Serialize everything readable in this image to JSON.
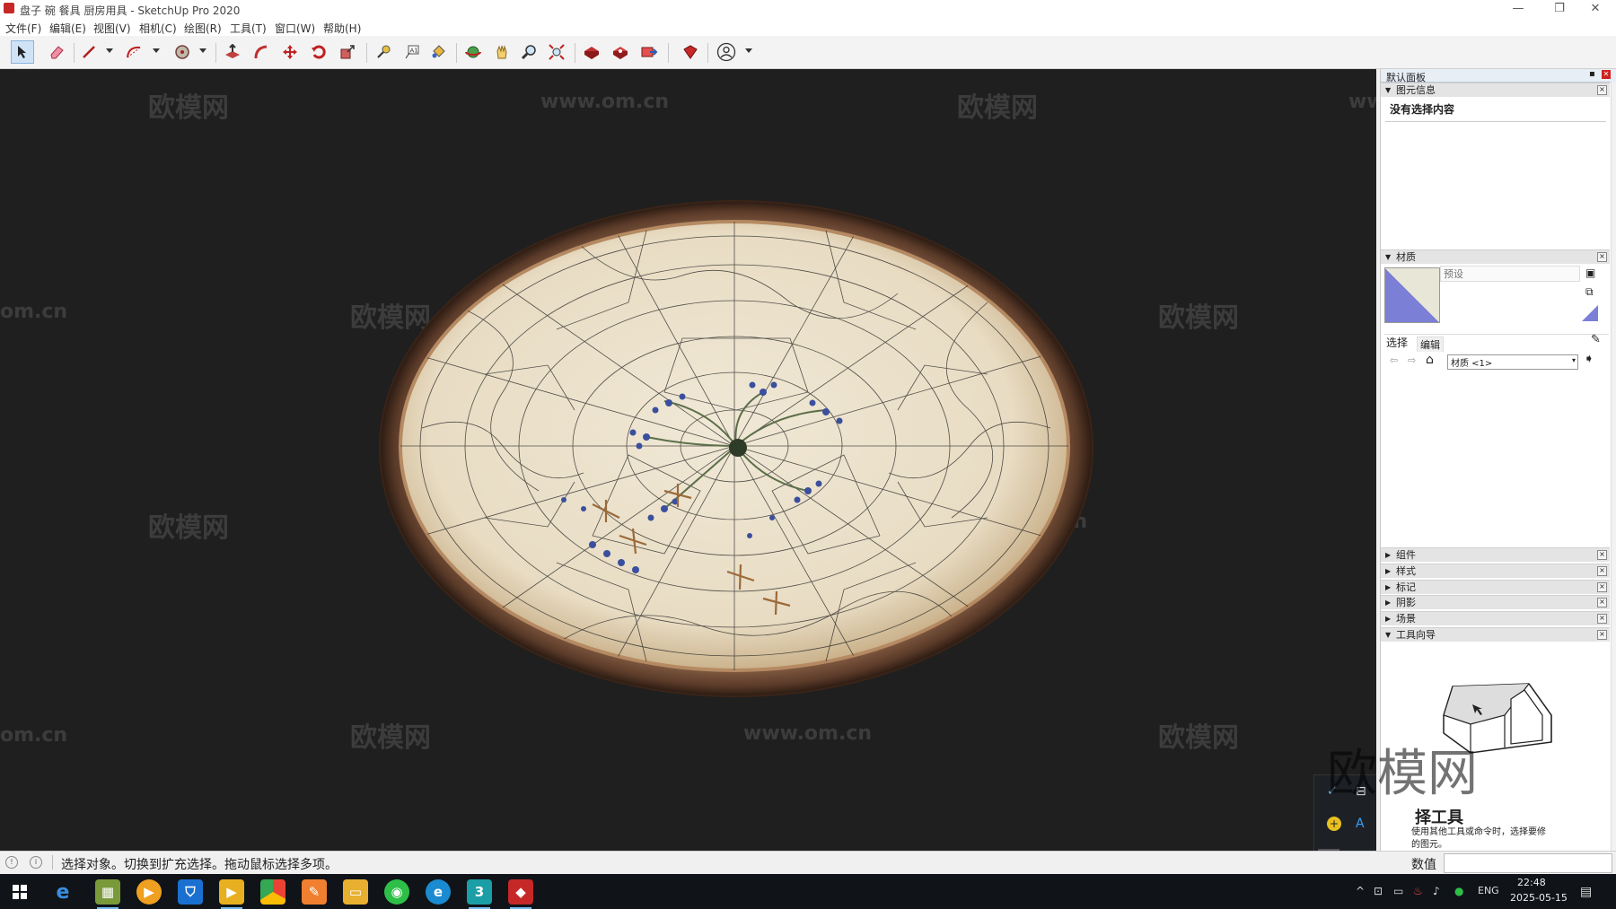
{
  "window": {
    "title": "盘子 碗 餐具 厨房用具 - SketchUp Pro 2020",
    "minimize": "—",
    "restore": "❐",
    "close": "✕"
  },
  "menu": [
    "文件(F)",
    "编辑(E)",
    "视图(V)",
    "相机(C)",
    "绘图(R)",
    "工具(T)",
    "窗口(W)",
    "帮助(H)"
  ],
  "watermarks": [
    "欧模网",
    "www.om.cn",
    "om.cn"
  ],
  "panel": {
    "title": "默认面板",
    "entity_info": {
      "header": "图元信息",
      "content": "没有选择内容"
    },
    "materials": {
      "header": "材质",
      "name_placeholder": "预设",
      "tab_select": "选择",
      "tab_edit": "编辑",
      "library": "材质 <1>",
      "swatch_color": "#7b7fd6"
    },
    "collapsed_sections": [
      "组件",
      "样式",
      "标记",
      "阴影",
      "场景"
    ],
    "instructor": {
      "header": "工具向导",
      "tool_title": "择工具",
      "desc_line1": "使用其他工具或命令时，选择要修",
      "desc_line2": "的图元。",
      "watermark": "欧模网"
    }
  },
  "status": {
    "text": "选择对象。切换到扩充选择。拖动鼠标选择多项。",
    "measure_label": "数值"
  },
  "taskbar": {
    "lang": "ENG",
    "time": "22:48",
    "date": "2025-05-15"
  },
  "colors": {
    "viewport_bg": "#1f1f1f",
    "plate_glaze": "#ece3cf",
    "plate_rim": "#6b4a36",
    "pattern_blue": "#3b4f9e",
    "pattern_green": "#5c6f4a",
    "pattern_brown": "#9c6a3a"
  }
}
